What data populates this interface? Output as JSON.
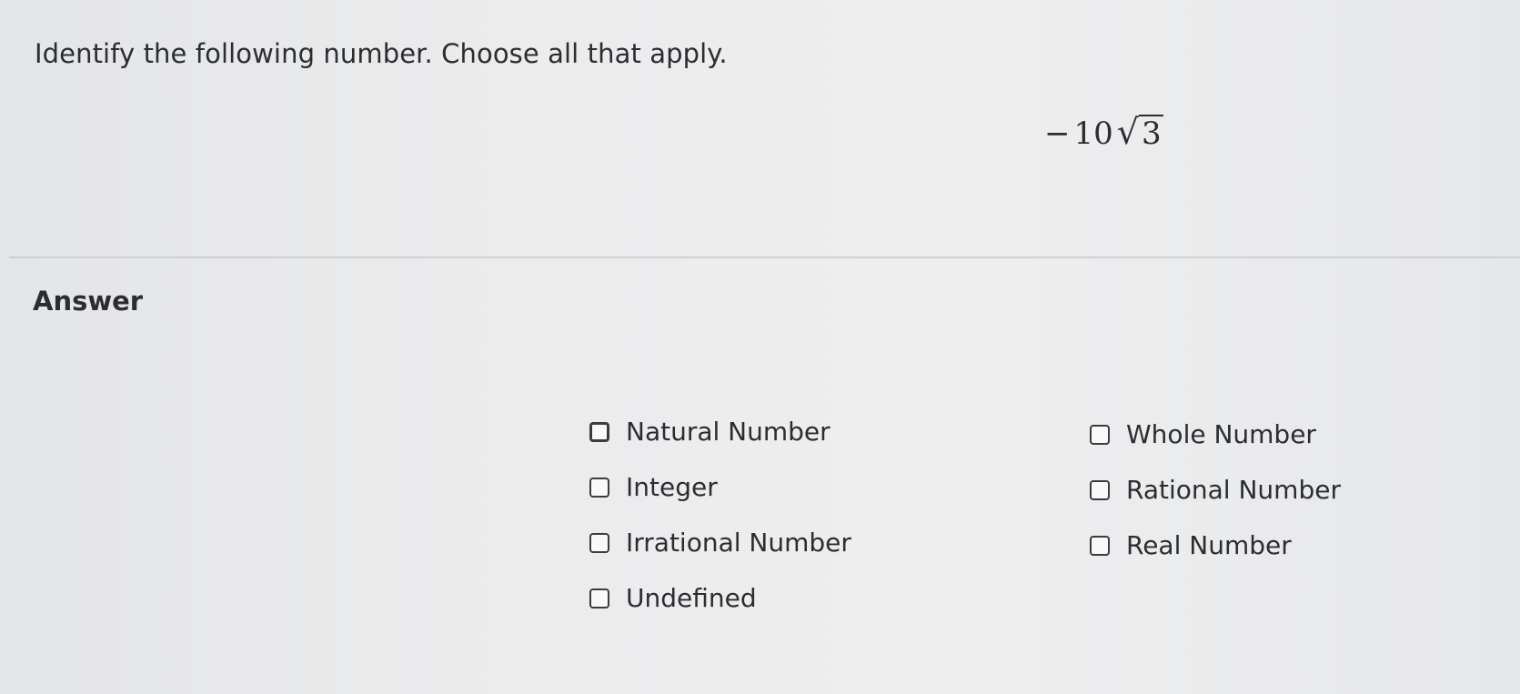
{
  "question": {
    "prompt": "Identify the following number. Choose all that apply.",
    "expression": {
      "sign": "−",
      "coefficient": "10",
      "radical_symbol": "√",
      "radicand": "3"
    }
  },
  "answer": {
    "title": "Answer",
    "options": [
      {
        "label": "Natural Number",
        "checked": false
      },
      {
        "label": "Whole Number",
        "checked": false
      },
      {
        "label": "Integer",
        "checked": false
      },
      {
        "label": "Rational Number",
        "checked": false
      },
      {
        "label": "Irrational Number",
        "checked": false
      },
      {
        "label": "Real Number",
        "checked": false
      },
      {
        "label": "Undefined",
        "checked": false
      }
    ]
  }
}
